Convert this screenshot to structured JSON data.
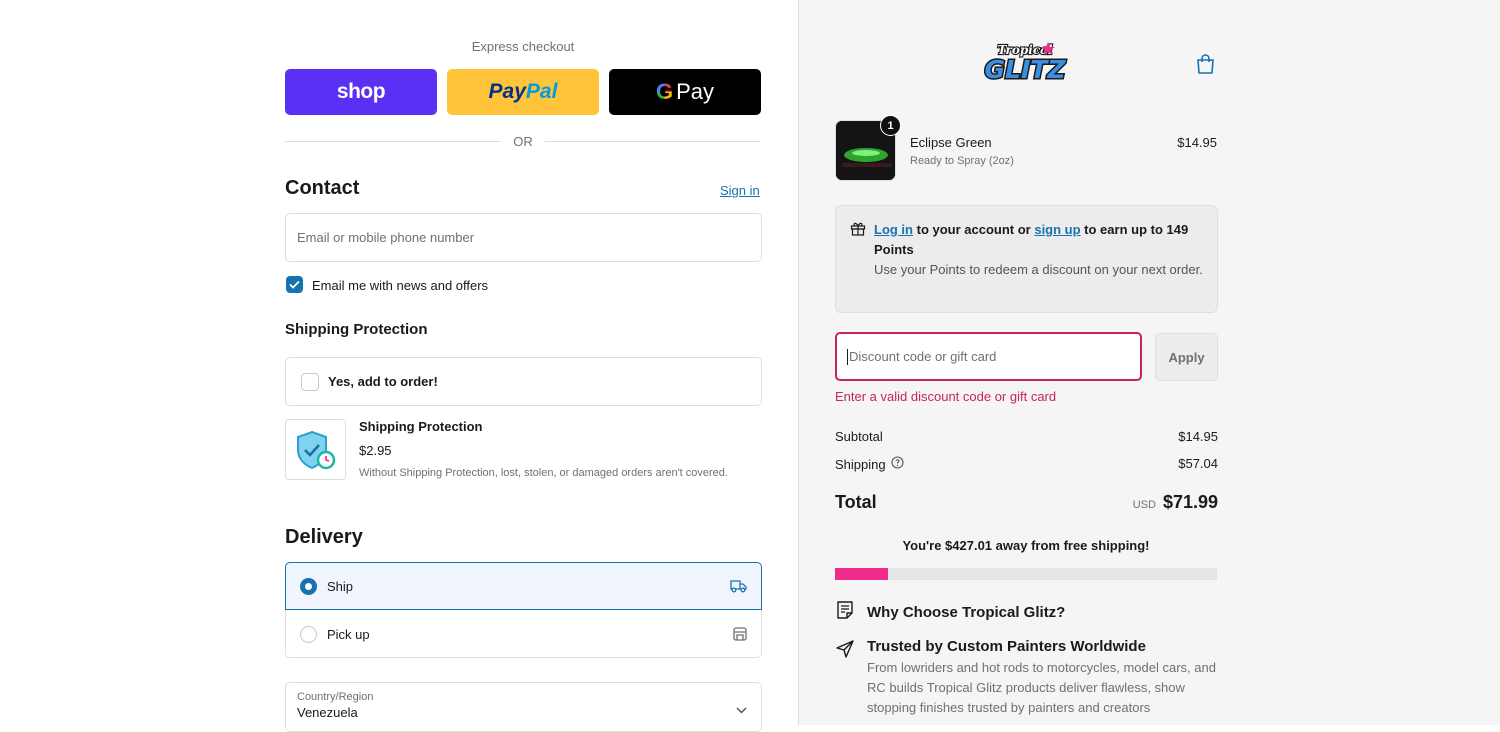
{
  "express": {
    "label": "Express checkout",
    "shop_label": "shop",
    "paypal_label_1": "Pay",
    "paypal_label_2": "Pal",
    "gpay_g": "G",
    "gpay_label": "Pay",
    "or_label": "OR"
  },
  "contact": {
    "title": "Contact",
    "sign_in": "Sign in",
    "email_placeholder": "Email or mobile phone number",
    "news_label": "Email me with news and offers",
    "news_checked": true
  },
  "shipping_protection": {
    "title": "Shipping Protection",
    "add_label": "Yes, add to order!",
    "add_checked": false,
    "name": "Shipping Protection",
    "price": "$2.95",
    "description": "Without Shipping Protection, lost, stolen, or damaged orders aren't covered."
  },
  "delivery": {
    "title": "Delivery",
    "options": [
      {
        "label": "Ship",
        "selected": true,
        "icon": "truck-icon"
      },
      {
        "label": "Pick up",
        "selected": false,
        "icon": "store-icon"
      }
    ],
    "country_label": "Country/Region",
    "country_value": "Venezuela"
  },
  "brand": {
    "logo_text_1": "Tropical",
    "logo_text_2": "GLITZ"
  },
  "cart": {
    "quantity": "1",
    "product_name": "Eclipse Green",
    "product_variant": "Ready to Spray (2oz)",
    "product_price": "$14.95"
  },
  "points": {
    "log_in": "Log in",
    "text_1": " to your account or ",
    "sign_up": "sign up",
    "text_2": " to earn up to 149 Points",
    "sub": "Use your Points to redeem a discount on your next order."
  },
  "discount": {
    "placeholder": "Discount code or gift card",
    "apply_label": "Apply",
    "error": "Enter a valid discount code or gift card"
  },
  "summary": {
    "subtotal_label": "Subtotal",
    "subtotal_value": "$14.95",
    "shipping_label": "Shipping",
    "shipping_value": "$57.04",
    "total_label": "Total",
    "currency": "USD",
    "total_value": "$71.99"
  },
  "free_shipping": {
    "message": "You're $427.01 away from free shipping!",
    "progress": 0.14,
    "color": "#ee2d8a"
  },
  "why": {
    "title": "Why Choose Tropical Glitz?",
    "trust_title": "Trusted by Custom Painters Worldwide",
    "trust_desc": "From lowriders and hot rods to motorcycles, model cars, and RC builds Tropical Glitz products deliver flawless, show stopping finishes trusted by painters and creators"
  },
  "colors": {
    "accent": "#1773b0",
    "error": "#c7245e",
    "shop": "#5a31f4",
    "paypal": "#ffc439"
  }
}
